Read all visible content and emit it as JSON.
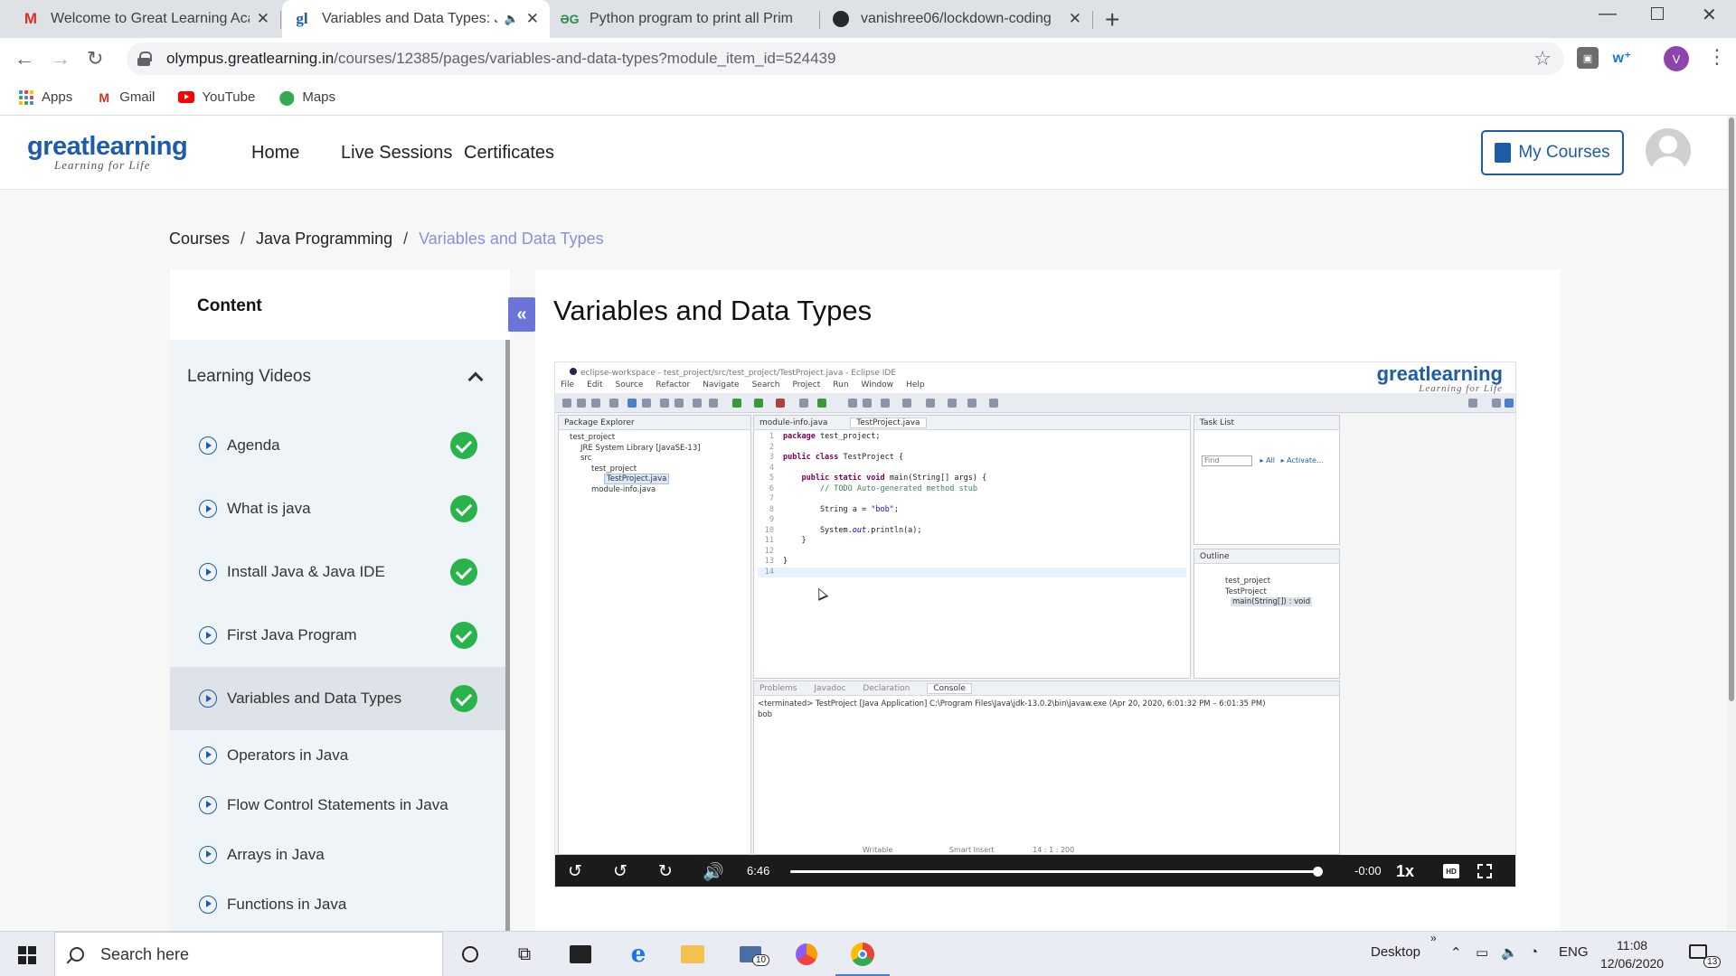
{
  "browser": {
    "tabs": [
      {
        "title": "Welcome to Great Learning Acad",
        "icon": "gmail-icon",
        "active": false
      },
      {
        "title": "Variables and Data Types: Jav",
        "icon": "greatlearning-favicon",
        "active": true
      },
      {
        "title": "Python program to print all Prim",
        "icon": "geeksforgeeks-favicon",
        "active": false
      },
      {
        "title": "vanishree06/lockdown-coding",
        "icon": "github-icon",
        "active": false
      }
    ],
    "url_host": "olympus.greatlearning.in",
    "url_path": "/courses/12385/pages/variables-and-data-types?module_item_id=524439",
    "profile_initial": "V",
    "bookmarks": [
      {
        "label": "Apps",
        "icon": "apps-grid-icon"
      },
      {
        "label": "Gmail",
        "icon": "gmail-icon"
      },
      {
        "label": "YouTube",
        "icon": "youtube-icon"
      },
      {
        "label": "Maps",
        "icon": "maps-pin-icon"
      }
    ]
  },
  "site": {
    "logo_main": "greatlearning",
    "logo_tagline": "Learning for Life",
    "nav": [
      "Home",
      "Live Sessions",
      "Certificates"
    ],
    "my_courses": "My Courses",
    "colors": {
      "brand": "#1c5ca8",
      "accent": "#6a74d9",
      "done": "#28b34b"
    }
  },
  "breadcrumb": [
    "Courses",
    "Java Programming",
    "Variables and Data Types"
  ],
  "sidebar": {
    "heading": "Content",
    "section": "Learning Videos",
    "items": [
      {
        "label": "Agenda",
        "done": true
      },
      {
        "label": "What is java",
        "done": true
      },
      {
        "label": "Install Java & Java IDE",
        "done": true
      },
      {
        "label": "First Java Program",
        "done": true
      },
      {
        "label": "Variables and Data Types",
        "done": true,
        "active": true
      },
      {
        "label": "Operators in Java",
        "done": false
      },
      {
        "label": "Flow Control Statements in Java",
        "done": false
      },
      {
        "label": "Arrays in Java",
        "done": false
      },
      {
        "label": "Functions in Java",
        "done": false
      }
    ]
  },
  "main": {
    "title": "Variables and Data Types"
  },
  "video": {
    "ide_title": "eclipse-workspace - test_project/src/test_project/TestProject.java - Eclipse IDE",
    "menu": [
      "File",
      "Edit",
      "Source",
      "Refactor",
      "Navigate",
      "Search",
      "Project",
      "Run",
      "Window",
      "Help"
    ],
    "package_explorer": "Package Explorer",
    "tree": [
      "test_project",
      "JRE System Library [JavaSE-13]",
      "src",
      "test_project",
      "TestProject.java",
      "module-info.java"
    ],
    "editor_tabs": [
      "module-info.java",
      "TestProject.java"
    ],
    "task_list": "Task List",
    "find_placeholder": "Find",
    "find_all": "All",
    "find_activate": "Activate...",
    "outline": "Outline",
    "outline_items": [
      "test_project",
      "TestProject",
      "main(String[]) : void"
    ],
    "bottom_tabs": [
      "Problems",
      "Javadoc",
      "Declaration",
      "Console"
    ],
    "console_status": "<terminated> TestProject [Java Application] C:\\Program Files\\Java\\jdk-13.0.2\\bin\\javaw.exe (Apr 20, 2020, 6:01:32 PM – 6:01:35 PM)",
    "console_output": "bob",
    "status_bar": [
      "Writable",
      "Smart Insert",
      "14 : 1 : 200"
    ],
    "elapsed": "6:46",
    "remaining": "-0:00",
    "progress": 1.0,
    "speed": "1x",
    "hd_label": "HD"
  },
  "taskbar": {
    "search_placeholder": "Search here",
    "mail_badge": "10",
    "desktop_label": "Desktop",
    "lang": "ENG",
    "time": "11:08",
    "date": "12/06/2020",
    "notifications": "13"
  }
}
